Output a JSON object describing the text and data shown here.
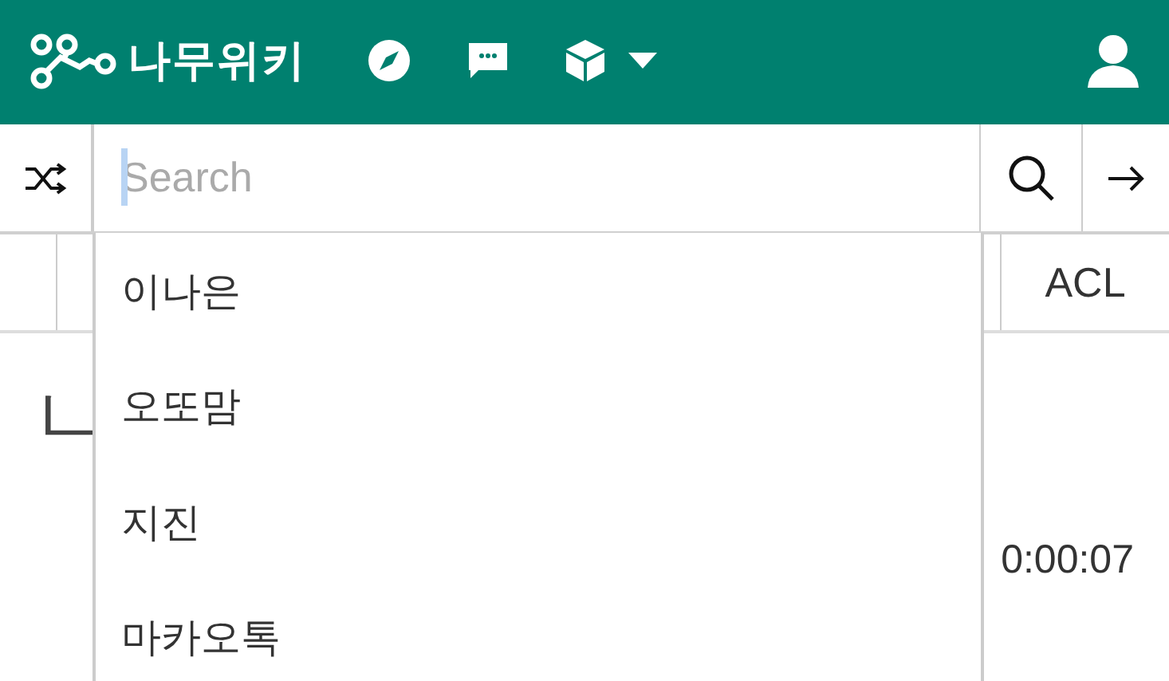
{
  "top_bar": {
    "logo": "나무위키"
  },
  "search": {
    "placeholder": "Search",
    "focused": true
  },
  "tabs": [
    {
      "label": "ACL"
    }
  ],
  "page": {
    "title": "ㄴ",
    "timestamp": "0:00:07"
  },
  "suggestions": [
    {
      "label": "이나은"
    },
    {
      "label": "오또맘"
    },
    {
      "label": "지진"
    },
    {
      "label": "마카오톡"
    }
  ]
}
